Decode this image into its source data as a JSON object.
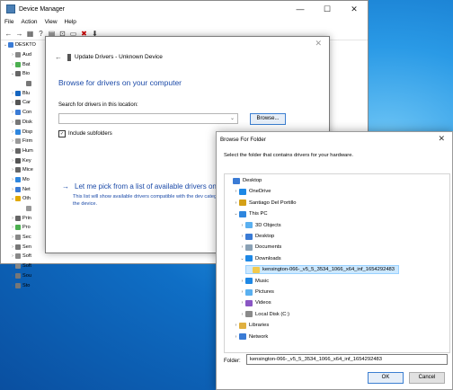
{
  "colors": {
    "accent": "#1b4aa8",
    "selection": "#cce8ff",
    "desktop": "#1d86d8"
  },
  "device_manager": {
    "title": "Device Manager",
    "window_buttons": {
      "minimize": "—",
      "maximize": "☐",
      "close": "✕"
    },
    "menu": [
      "File",
      "Action",
      "View",
      "Help"
    ],
    "toolbar_icons": [
      "back-icon",
      "forward-icon",
      "properties-icon",
      "help-icon",
      "update-driver-icon",
      "scan-icon",
      "monitor-icon",
      "uninstall-icon",
      "download-icon"
    ],
    "tree": [
      {
        "label": "DESKTO",
        "chevron": "⌄",
        "icon": "computer-icon"
      },
      {
        "label": "Aud",
        "chevron": "›",
        "icon": "audio-icon"
      },
      {
        "label": "Bat",
        "chevron": "›",
        "icon": "battery-icon"
      },
      {
        "label": "Bio",
        "chevron": "⌄",
        "icon": "biometric-icon"
      },
      {
        "label": "",
        "chevron": "",
        "icon": "fingerprint-icon"
      },
      {
        "label": "Blu",
        "chevron": "›",
        "icon": "bluetooth-icon"
      },
      {
        "label": "Car",
        "chevron": "›",
        "icon": "camera-icon"
      },
      {
        "label": "Con",
        "chevron": "›",
        "icon": "computer-icon"
      },
      {
        "label": "Disk",
        "chevron": "›",
        "icon": "disk-icon"
      },
      {
        "label": "Disp",
        "chevron": "›",
        "icon": "display-icon"
      },
      {
        "label": "Firm",
        "chevron": "›",
        "icon": "firmware-icon"
      },
      {
        "label": "Hum",
        "chevron": "›",
        "icon": "hid-icon"
      },
      {
        "label": "Key",
        "chevron": "›",
        "icon": "keyboard-icon"
      },
      {
        "label": "Mice",
        "chevron": "›",
        "icon": "mouse-icon"
      },
      {
        "label": "Mo",
        "chevron": "›",
        "icon": "monitor-icon"
      },
      {
        "label": "Net",
        "chevron": "›",
        "icon": "network-icon"
      },
      {
        "label": "Oth",
        "chevron": "⌄",
        "icon": "warning-icon"
      },
      {
        "label": "",
        "chevron": "",
        "icon": "unknown-device-icon"
      },
      {
        "label": "Prin",
        "chevron": "›",
        "icon": "printer-icon"
      },
      {
        "label": "Pro",
        "chevron": "›",
        "icon": "processor-icon"
      },
      {
        "label": "Sec",
        "chevron": "›",
        "icon": "security-icon"
      },
      {
        "label": "Sen",
        "chevron": "›",
        "icon": "sensor-icon"
      },
      {
        "label": "Soft",
        "chevron": "›",
        "icon": "software-icon"
      },
      {
        "label": "Soft",
        "chevron": "›",
        "icon": "software-icon"
      },
      {
        "label": "Sou",
        "chevron": "›",
        "icon": "sound-icon"
      },
      {
        "label": "Sto",
        "chevron": "›",
        "icon": "storage-icon"
      }
    ]
  },
  "update_drivers": {
    "header": "Update Drivers - Unknown Device",
    "back_glyph": "←",
    "close_glyph": "✕",
    "heading": "Browse for drivers on your computer",
    "search_label": "Search for drivers in this location:",
    "search_value": "",
    "dropdown_glyph": "⌄",
    "browse_label": "Browse...",
    "include_subfolders_label": "Include subfolders",
    "include_subfolders_checked": true,
    "check_glyph": "✓",
    "pick_arrow": "→",
    "pick_label": "Let me pick from a list of available drivers on",
    "pick_description": "This list will show available drivers compatible with the dev category as the device."
  },
  "browse_folder": {
    "title": "Browse For Folder",
    "close_glyph": "✕",
    "instruction": "Select the folder that contains drivers for your hardware.",
    "tree": [
      {
        "label": "Desktop",
        "chevron": "",
        "icon": "desktop-folder-icon",
        "indent": 0,
        "selected": false
      },
      {
        "label": "OneDrive",
        "chevron": "›",
        "icon": "onedrive-icon",
        "indent": 1,
        "selected": false
      },
      {
        "label": "Santiago Del Portillo",
        "chevron": "›",
        "icon": "user-icon",
        "indent": 1,
        "selected": false
      },
      {
        "label": "This PC",
        "chevron": "⌄",
        "icon": "pc-icon",
        "indent": 1,
        "selected": false
      },
      {
        "label": "3D Objects",
        "chevron": "›",
        "icon": "objects-3d-icon",
        "indent": 2,
        "selected": false
      },
      {
        "label": "Desktop",
        "chevron": "›",
        "icon": "desktop-folder-icon",
        "indent": 2,
        "selected": false
      },
      {
        "label": "Documents",
        "chevron": "›",
        "icon": "documents-icon",
        "indent": 2,
        "selected": false
      },
      {
        "label": "Downloads",
        "chevron": "⌄",
        "icon": "downloads-icon",
        "indent": 2,
        "selected": false
      },
      {
        "label": "kensington-066-_v5_5_3534_1066_x64_inf_1654292483",
        "chevron": "",
        "icon": "folder-icon",
        "indent": 3,
        "selected": true
      },
      {
        "label": "Music",
        "chevron": "›",
        "icon": "music-icon",
        "indent": 2,
        "selected": false
      },
      {
        "label": "Pictures",
        "chevron": "›",
        "icon": "pictures-icon",
        "indent": 2,
        "selected": false
      },
      {
        "label": "Videos",
        "chevron": "›",
        "icon": "videos-icon",
        "indent": 2,
        "selected": false
      },
      {
        "label": "Local Disk (C:)",
        "chevron": "›",
        "icon": "drive-icon",
        "indent": 2,
        "selected": false
      },
      {
        "label": "Libraries",
        "chevron": "›",
        "icon": "libraries-icon",
        "indent": 1,
        "selected": false
      },
      {
        "label": "Network",
        "chevron": "›",
        "icon": "network-icon",
        "indent": 1,
        "selected": false
      }
    ],
    "scroll_glyph": "⌄",
    "folder_label": "Folder:",
    "folder_value": "kensington-066-_v5_5_3534_1066_x64_inf_1654292483",
    "ok_label": "OK",
    "cancel_label": "Cancel"
  }
}
